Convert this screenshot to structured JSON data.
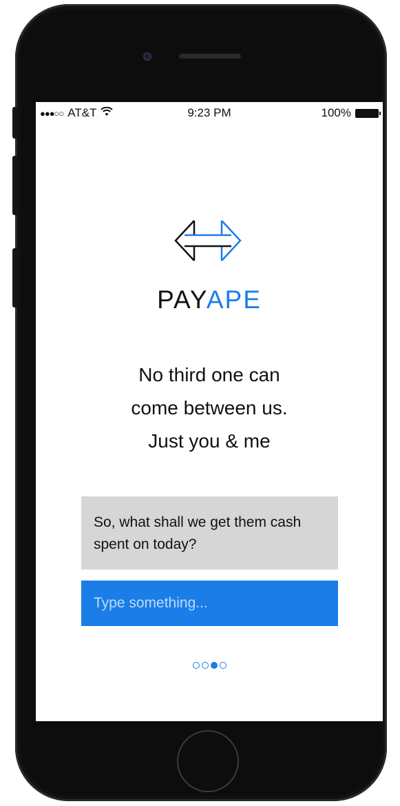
{
  "status_bar": {
    "signal": "●●●○○",
    "carrier": "AT&T",
    "wifi_icon": "wifi-icon",
    "time": "9:23 PM",
    "battery_text": "100%"
  },
  "brand": {
    "part1": "PAY",
    "part2": "APE",
    "primary_color": "#111111",
    "accent_color": "#1a7de8"
  },
  "tagline": {
    "line1": "No third one can",
    "line2": "come between us.",
    "line3": "Just you & me"
  },
  "bubble": {
    "text": "So, what shall we get them cash spent on today?"
  },
  "chat_input": {
    "value": "",
    "placeholder": "Type something..."
  },
  "pager": {
    "pages": 4,
    "active_index": 2
  }
}
